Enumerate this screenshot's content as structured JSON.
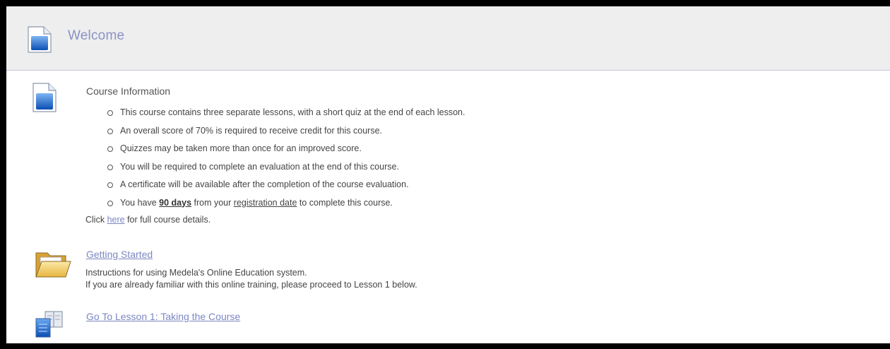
{
  "header": {
    "title": "Welcome",
    "icon": "document-icon"
  },
  "course_info": {
    "title": "Course Information",
    "icon": "document-icon",
    "bullets": [
      "This course contains three separate lessons, with a short quiz at the end of each lesson.",
      "An overall score of 70% is required to receive credit for this course.",
      "Quizzes may be taken more than once for an improved score.",
      "You will be required to complete an evaluation at the end of this course.",
      "A certificate will be available after the completion of the course evaluation."
    ],
    "last_bullet": {
      "prefix": "You have ",
      "days": "90 days",
      "middle": " from your ",
      "registration": "registration date",
      "suffix": " to complete this course."
    },
    "click_prefix": "Click ",
    "click_link": "here",
    "click_suffix": " for full course details."
  },
  "getting_started": {
    "icon": "folder-icon",
    "link": "Getting Started",
    "desc_line1": "Instructions for using Medela's Online Education system.",
    "desc_line2": "If you are already familiar with this online training, please proceed to Lesson 1 below."
  },
  "lesson1": {
    "icon": "lesson-book-icon",
    "link": "Go To Lesson 1: Taking the Course"
  },
  "colors": {
    "link": "#7c86c2",
    "header_bg": "#eeeeee",
    "icon_blue": "#1f6fd8"
  }
}
